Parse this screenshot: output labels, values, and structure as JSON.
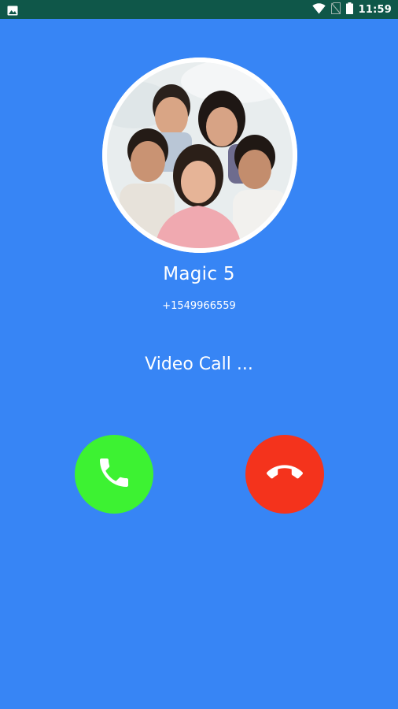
{
  "status_bar": {
    "time": "11:59",
    "icons": [
      "image-notification-icon",
      "wifi-icon",
      "no-sim-icon",
      "battery-icon"
    ]
  },
  "caller": {
    "name": "Magic 5",
    "number": "+1549966559",
    "avatar": "group-photo-avatar"
  },
  "call": {
    "status": "Video Call ..."
  },
  "buttons": {
    "accept_icon": "phone-icon",
    "decline_icon": "hang-up-icon"
  },
  "colors": {
    "background": "#3785F5",
    "status_bar": "#0F5749",
    "accept": "#3DF232",
    "decline": "#F4331C"
  }
}
